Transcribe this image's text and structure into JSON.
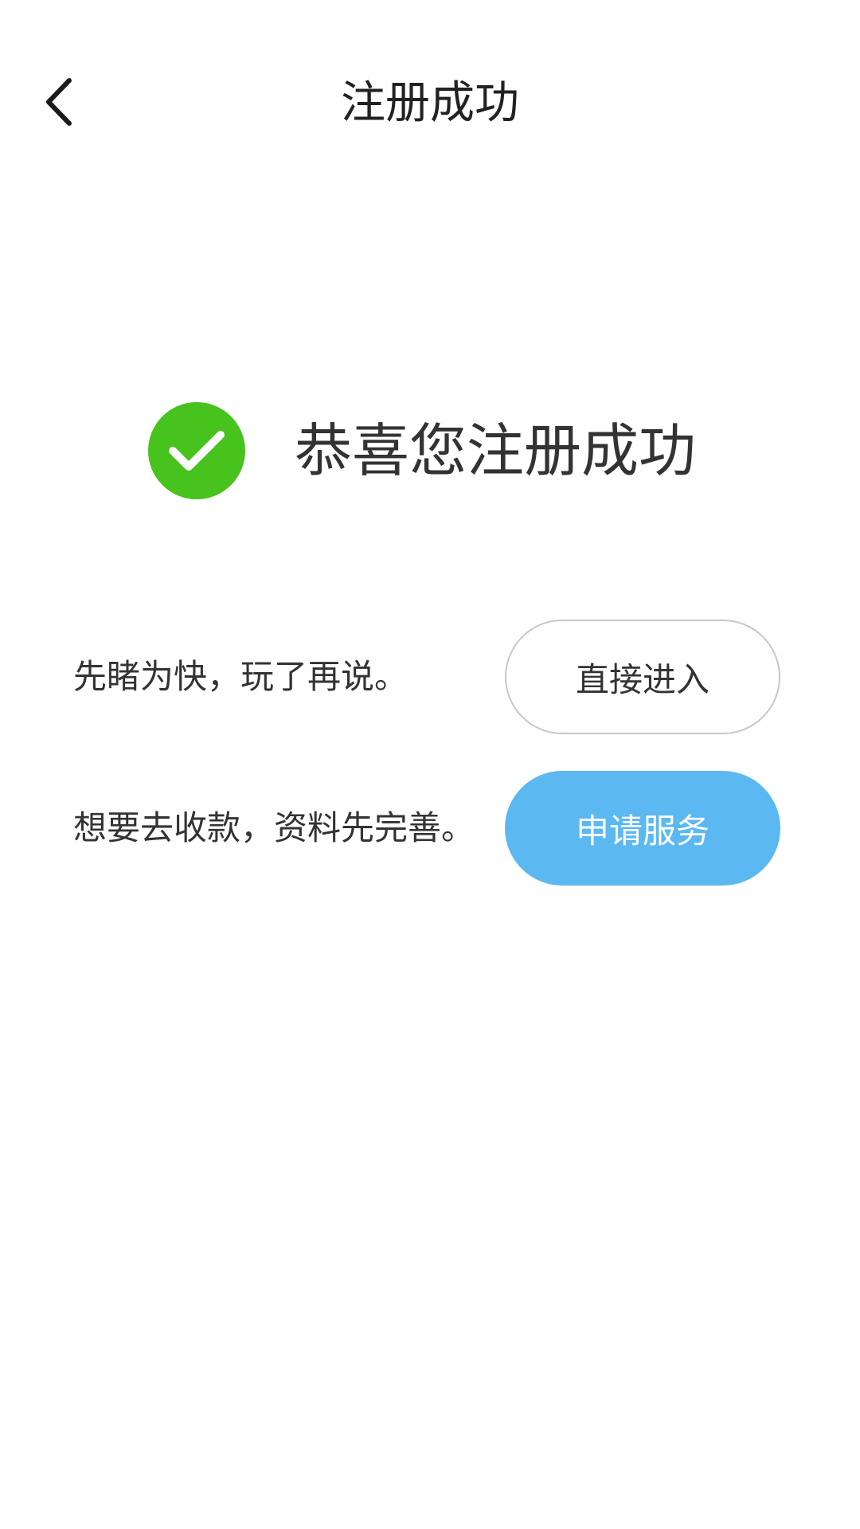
{
  "header": {
    "title": "注册成功",
    "back_icon": "chevron-left-icon"
  },
  "success": {
    "icon": "check-circle-icon",
    "icon_color": "#48c21d",
    "message": "恭喜您注册成功"
  },
  "options": [
    {
      "text": "先睹为快，玩了再说。",
      "button_label": "直接进入",
      "button_style": "outline"
    },
    {
      "text": "想要去收款，资料先完善。",
      "button_label": "申请服务",
      "button_style": "filled",
      "button_color": "#5bb8f1"
    }
  ]
}
